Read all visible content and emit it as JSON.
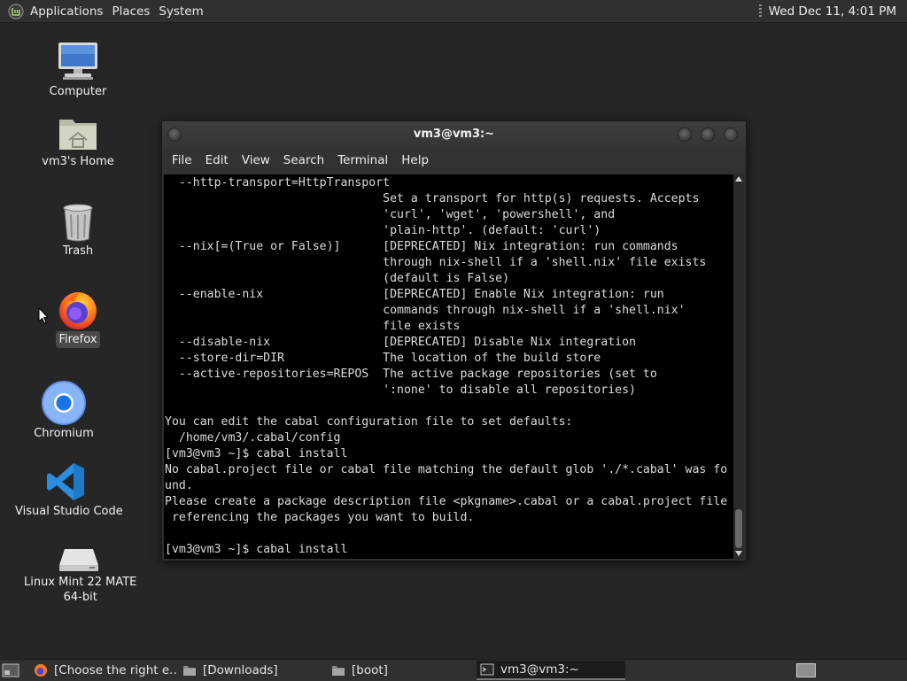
{
  "top_panel": {
    "menus": [
      "Applications",
      "Places",
      "System"
    ],
    "clock": "Wed Dec 11,  4:01 PM"
  },
  "desktop": {
    "icons": [
      {
        "label": "Computer",
        "icon": "computer-icon"
      },
      {
        "label": "vm3's Home",
        "icon": "home-folder-icon"
      },
      {
        "label": "Trash",
        "icon": "trash-icon"
      },
      {
        "label": "Firefox",
        "icon": "firefox-icon",
        "selected": true
      },
      {
        "label": "Chromium",
        "icon": "chromium-icon"
      },
      {
        "label": "Visual Studio Code",
        "icon": "vscode-icon"
      },
      {
        "label": "Linux Mint 22 MATE\n64-bit",
        "icon": "disc-drive-icon"
      }
    ]
  },
  "terminal": {
    "title": "vm3@vm3:~",
    "menus": [
      "File",
      "Edit",
      "View",
      "Search",
      "Terminal",
      "Help"
    ],
    "lines": [
      "  --http-transport=HttpTransport",
      "                               Set a transport for http(s) requests. Accepts",
      "                               'curl', 'wget', 'powershell', and",
      "                               'plain-http'. (default: 'curl')",
      "  --nix[=(True or False)]      [DEPRECATED] Nix integration: run commands",
      "                               through nix-shell if a 'shell.nix' file exists",
      "                               (default is False)",
      "  --enable-nix                 [DEPRECATED] Enable Nix integration: run",
      "                               commands through nix-shell if a 'shell.nix'",
      "                               file exists",
      "  --disable-nix                [DEPRECATED] Disable Nix integration",
      "  --store-dir=DIR              The location of the build store",
      "  --active-repositories=REPOS  The active package repositories (set to",
      "                               ':none' to disable all repositories)",
      "",
      "You can edit the cabal configuration file to set defaults:",
      "  /home/vm3/.cabal/config",
      "[vm3@vm3 ~]$ cabal install",
      "No cabal.project file or cabal file matching the default glob './*.cabal' was fo",
      "und.",
      "Please create a package description file <pkgname>.cabal or a cabal.project file",
      " referencing the packages you want to build.",
      "",
      "[vm3@vm3 ~]$ cabal install"
    ]
  },
  "taskbar": {
    "tasks": [
      {
        "label": "[Choose the right e...",
        "icon": "firefox-icon",
        "active": false
      },
      {
        "label": "[Downloads]",
        "icon": "folder-icon",
        "active": false
      },
      {
        "label": "[boot]",
        "icon": "folder-icon",
        "active": false
      },
      {
        "label": "vm3@vm3:~",
        "icon": "terminal-icon",
        "active": true
      }
    ]
  }
}
